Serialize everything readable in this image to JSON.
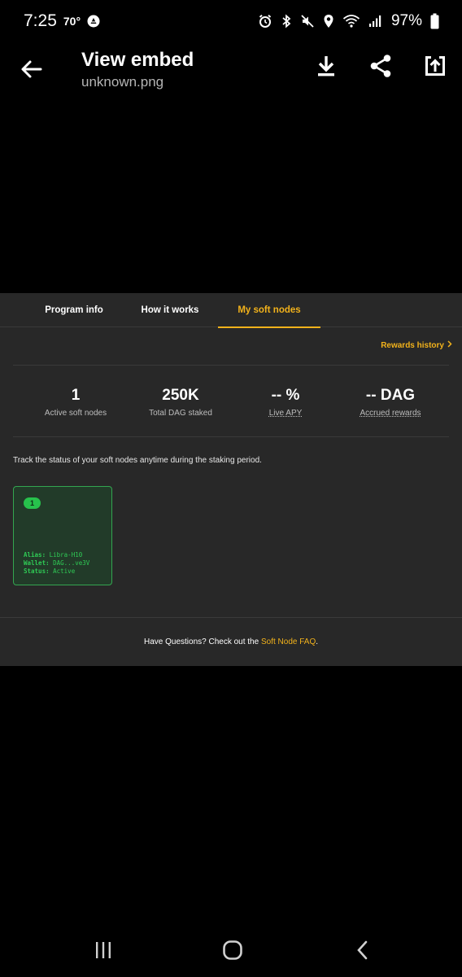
{
  "status_bar": {
    "time": "7:25",
    "temperature": "70°",
    "battery": "97%",
    "icons": [
      "alarm-icon",
      "bluetooth-icon",
      "mute-icon",
      "location-icon",
      "wifi-icon",
      "signal-icon",
      "battery-icon"
    ]
  },
  "app_bar": {
    "title": "View embed",
    "subtitle": "unknown.png",
    "actions": [
      "download-icon",
      "share-icon",
      "open-external-icon"
    ]
  },
  "embed": {
    "tabs": [
      {
        "label": "Program info",
        "active": false
      },
      {
        "label": "How it works",
        "active": false
      },
      {
        "label": "My soft nodes",
        "active": true
      }
    ],
    "rewards_history": "Rewards history",
    "stats": [
      {
        "value": "1",
        "label": "Active soft nodes"
      },
      {
        "value": "250K",
        "label": "Total DAG staked"
      },
      {
        "value": "-- %",
        "label": "Live APY"
      },
      {
        "value": "-- DAG",
        "label": "Accrued rewards"
      }
    ],
    "track_text": "Track the status of your soft nodes anytime during the staking period.",
    "node": {
      "badge": "1",
      "alias_key": "Alias:",
      "alias_value": "Libra-H10",
      "wallet_key": "Wallet:",
      "wallet_value": "DAG...ve3V",
      "status_key": "Status:",
      "status_value": "Active"
    },
    "faq_prefix": "Have Questions? Check out the ",
    "faq_link": "Soft Node FAQ",
    "faq_suffix": "."
  },
  "colors": {
    "accent": "#f2b21b",
    "node_green": "#2fcb55",
    "card_bg": "#282828"
  },
  "nav_bar": [
    "recents-icon",
    "home-icon",
    "back-nav-icon"
  ]
}
